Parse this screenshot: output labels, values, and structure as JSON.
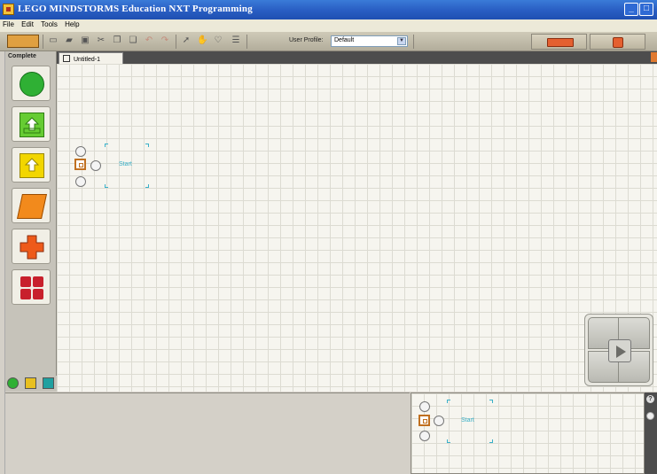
{
  "window": {
    "title": "LEGO MINDSTORMS Education NXT Programming",
    "minimize_label": "_",
    "maximize_label": "□"
  },
  "menu": {
    "items": [
      "File",
      "Edit",
      "Tools",
      "Help"
    ]
  },
  "toolbar": {
    "profile_label": "User Profile:",
    "profile_value": "Default",
    "icons": [
      "new-icon",
      "open-icon",
      "save-icon",
      "cut-icon",
      "copy-icon",
      "paste-icon",
      "undo-icon",
      "redo-icon",
      "pointer-icon",
      "pan-icon",
      "comment-icon",
      "custom-palette-icon"
    ]
  },
  "palette": {
    "title": "Complete",
    "blocks": [
      {
        "name": "common-palette-block",
        "color": "#2fb034"
      },
      {
        "name": "action-palette-block",
        "color": "#66cc33"
      },
      {
        "name": "sensor-palette-block",
        "color": "#f2d600"
      },
      {
        "name": "flow-palette-block",
        "color": "#f28a1c"
      },
      {
        "name": "data-palette-block",
        "color": "#e84c1c"
      },
      {
        "name": "advanced-palette-block",
        "color": "#c8202c"
      }
    ]
  },
  "document": {
    "tab_label": "Untitled-1",
    "start_label": "Start"
  },
  "minimap": {
    "start_label": "Start"
  },
  "colors": {
    "accent": "#39b0c8",
    "titlebar": "#2a5fc4",
    "canvas": "#f6f5ef"
  }
}
